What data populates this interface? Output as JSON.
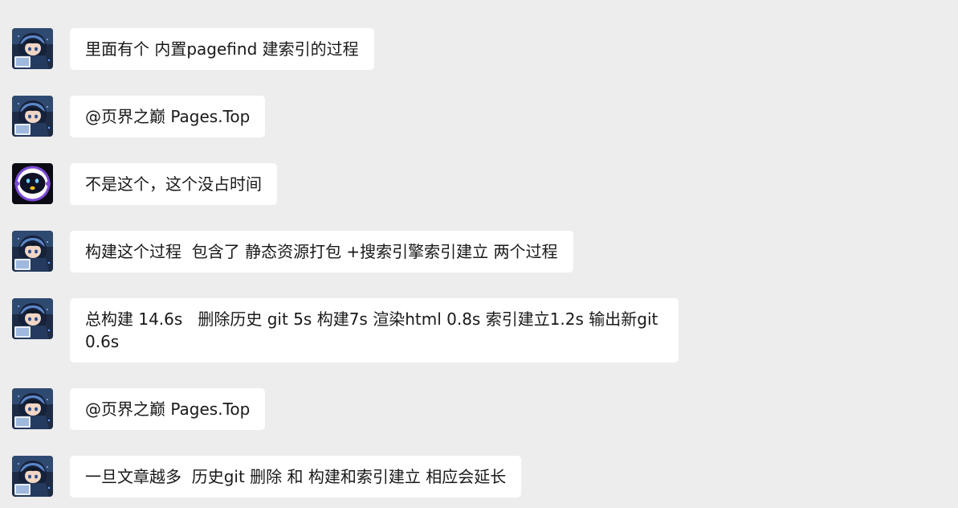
{
  "messages": [
    {
      "sender": "user-anime",
      "avatar_icon": "anime-girl-avatar-icon",
      "text": "里面有个 内置pagefind 建索引的过程"
    },
    {
      "sender": "user-anime",
      "avatar_icon": "anime-girl-avatar-icon",
      "text": "@页界之巅 Pages.Top"
    },
    {
      "sender": "bot",
      "avatar_icon": "robot-avatar-icon",
      "text": "不是这个，这个没占时间"
    },
    {
      "sender": "user-anime",
      "avatar_icon": "anime-girl-avatar-icon",
      "text": "构建这个过程  包含了 静态资源打包 +搜索引擎索引建立 两个过程"
    },
    {
      "sender": "user-anime",
      "avatar_icon": "anime-girl-avatar-icon",
      "text": "总构建 14.6s   删除历史 git 5s 构建7s 渲染html 0.8s 索引建立1.2s 输出新git 0.6s"
    },
    {
      "sender": "user-anime",
      "avatar_icon": "anime-girl-avatar-icon",
      "text": "@页界之巅 Pages.Top"
    },
    {
      "sender": "user-anime",
      "avatar_icon": "anime-girl-avatar-icon",
      "text": "一旦文章越多  历史git 删除 和 构建和索引建立 相应会延长"
    }
  ],
  "colors": {
    "background": "#ededed",
    "bubble": "#ffffff",
    "text": "#191919"
  }
}
